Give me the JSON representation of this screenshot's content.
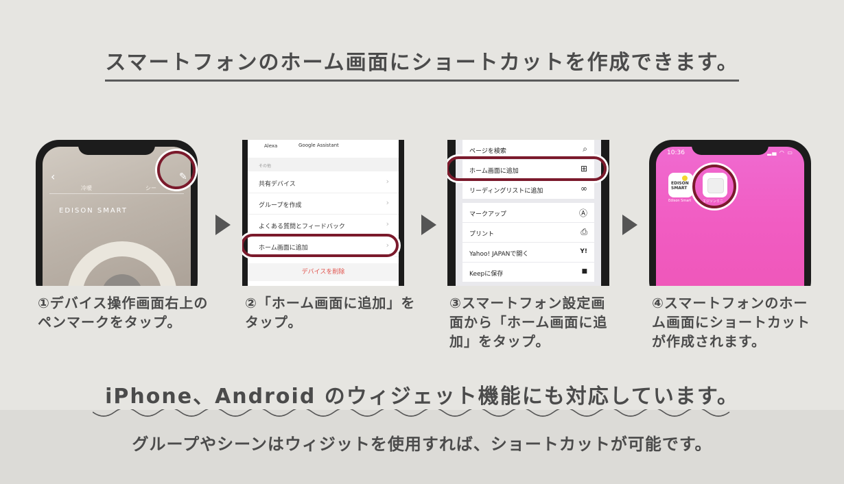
{
  "headline": "スマートフォンのホーム画面にショートカットを作成できます。",
  "steps": [
    {
      "caption": "①デバイス操作画面右上のペンマークをタップ。",
      "screen": {
        "tabs": [
          "冷暖",
          "シー"
        ],
        "logo": "EDISON SMART",
        "back_icon": "chevron-left-icon",
        "edit_icon": "pen-icon"
      }
    },
    {
      "caption": "②「ホーム画面に追加」をタップ。",
      "screen": {
        "header_items": [
          "Alexa",
          "Google Assistant"
        ],
        "section": "その他",
        "items": [
          "共有デバイス",
          "グループを作成",
          "よくある質問とフィードバック",
          "ホーム画面に追加"
        ],
        "delete_label": "デバイスを削除"
      }
    },
    {
      "caption": "③スマートフォン設定画面から「ホーム画面に追加」をタップ。",
      "screen": {
        "rows": [
          {
            "label": "ページを検索",
            "icon": "search-icon"
          },
          {
            "label": "ホーム画面に追加",
            "icon": "plus-square-icon"
          },
          {
            "label": "リーディングリストに追加",
            "icon": "glasses-icon"
          },
          {
            "label": "マークアップ",
            "icon": "markup-icon"
          },
          {
            "label": "プリント",
            "icon": "printer-icon"
          },
          {
            "label": "Yahoo! JAPANで開く",
            "icon": "yahoo-icon"
          },
          {
            "label": "Keepに保存",
            "icon": "bookmark-icon"
          }
        ]
      }
    },
    {
      "caption": "④スマートフォンのホーム画面にショートカットが作成されます。",
      "screen": {
        "time": "10:36",
        "app1_logo": "EDISON SMART",
        "app1_label": "Edison Smart",
        "app2_label": "エジソンミニ"
      }
    }
  ],
  "sub_headline": "iPhone、Android のウィジェット機能にも対応しています。",
  "note": "グループやシーンはウィジットを使用すれば、ショートカットが可能です。",
  "colors": {
    "highlight": "#7b1a2c",
    "home_screen": "#f15cc2",
    "text": "#4b4b4b",
    "delete": "#e0504a"
  }
}
